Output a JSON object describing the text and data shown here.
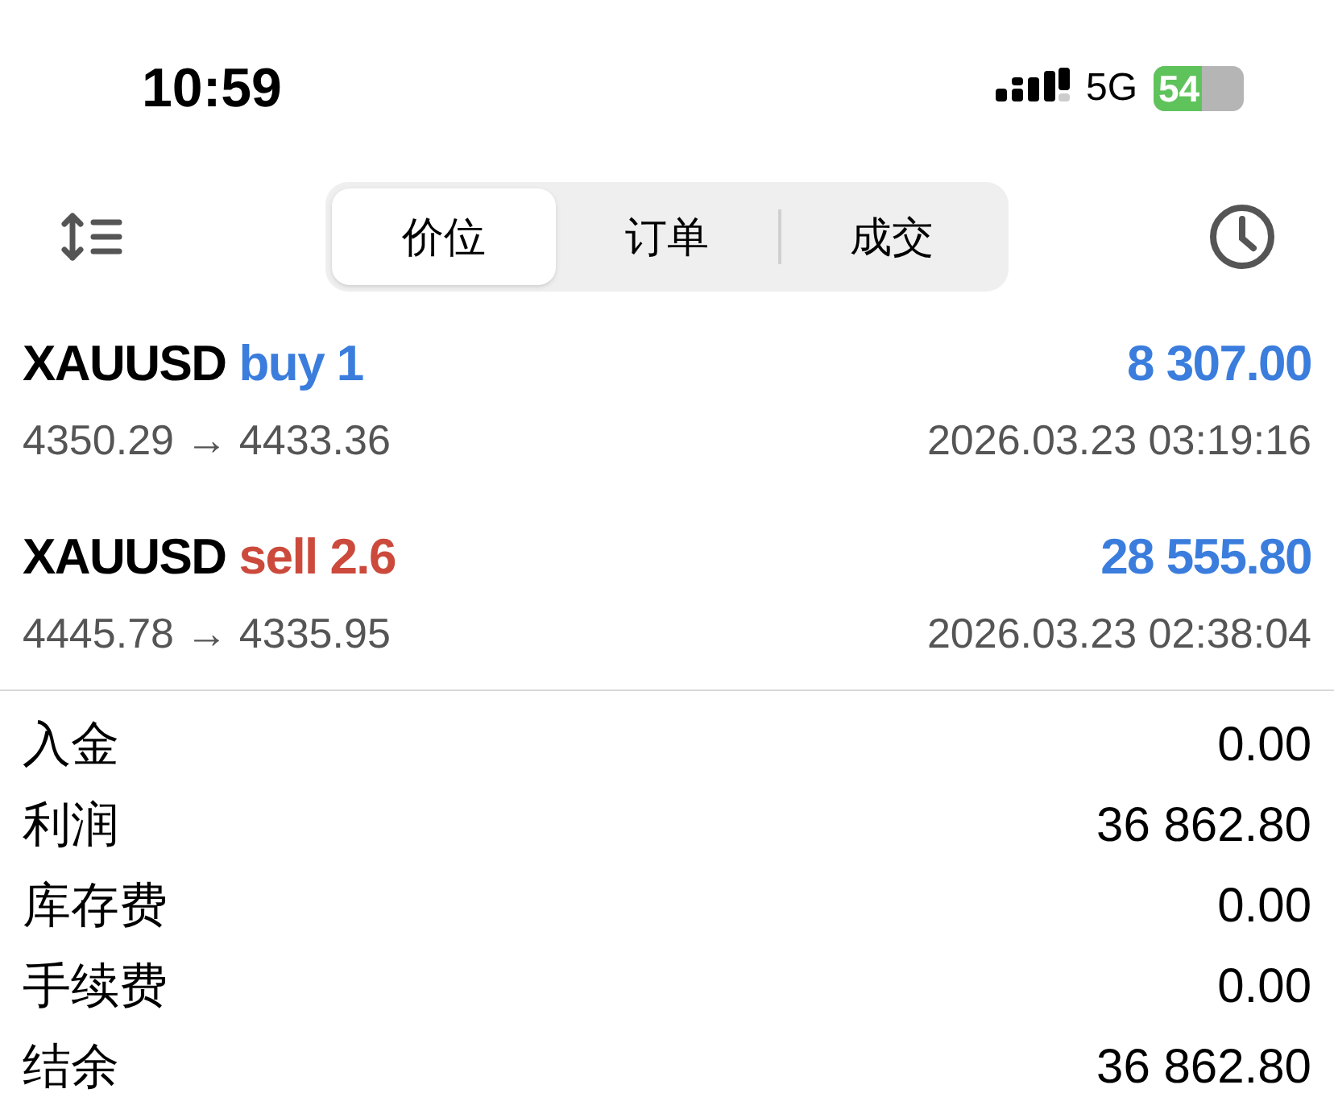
{
  "status_bar": {
    "time": "10:59",
    "network": "5G",
    "battery": "54"
  },
  "tabs": [
    {
      "label": "价位",
      "selected": true
    },
    {
      "label": "订单",
      "selected": false
    },
    {
      "label": "成交",
      "selected": false
    }
  ],
  "trades": [
    {
      "symbol": "XAUUSD",
      "kind": "buy",
      "side": "buy 1",
      "profit": "8 307.00",
      "prices": "4350.29 → 4433.36",
      "time": "2026.03.23 03:19:16"
    },
    {
      "symbol": "XAUUSD",
      "kind": "sell",
      "side": "sell 2.6",
      "profit": "28 555.80",
      "prices": "4445.78 → 4335.95",
      "time": "2026.03.23 02:38:04"
    }
  ],
  "summary": [
    {
      "label": "入金",
      "value": "0.00"
    },
    {
      "label": "利润",
      "value": "36 862.80"
    },
    {
      "label": "库存费",
      "value": "0.00"
    },
    {
      "label": "手续费",
      "value": "0.00"
    },
    {
      "label": "结余",
      "value": "36 862.80"
    }
  ]
}
